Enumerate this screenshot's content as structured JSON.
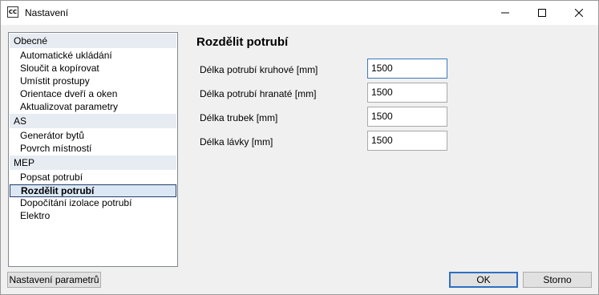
{
  "window": {
    "icon_text": "CC",
    "title": "Nastavení"
  },
  "sidebar": {
    "groups": [
      {
        "label": "Obecné",
        "items": [
          {
            "label": "Automatické ukládání"
          },
          {
            "label": "Sloučit a kopírovat"
          },
          {
            "label": "Umístit prostupy"
          },
          {
            "label": "Orientace dveří a oken"
          },
          {
            "label": "Aktualizovat parametry"
          }
        ]
      },
      {
        "label": "AS",
        "items": [
          {
            "label": "Generátor bytů"
          },
          {
            "label": "Povrch místností"
          }
        ]
      },
      {
        "label": "MEP",
        "items": [
          {
            "label": "Popsat potrubí"
          },
          {
            "label": "Rozdělit potrubí",
            "selected": true
          },
          {
            "label": "Dopočítání izolace potrubí"
          },
          {
            "label": "Elektro"
          }
        ]
      }
    ]
  },
  "main": {
    "title": "Rozdělit potrubí",
    "fields": [
      {
        "label": "Délka potrubí kruhové [mm]",
        "value": "1500"
      },
      {
        "label": "Délka potrubí hranaté [mm]",
        "value": "1500"
      },
      {
        "label": "Délka trubek [mm]",
        "value": "1500"
      },
      {
        "label": "Délka lávky [mm]",
        "value": "1500"
      }
    ]
  },
  "footer": {
    "params_button": "Nastavení parametrů",
    "ok_button": "OK",
    "cancel_button": "Storno"
  }
}
